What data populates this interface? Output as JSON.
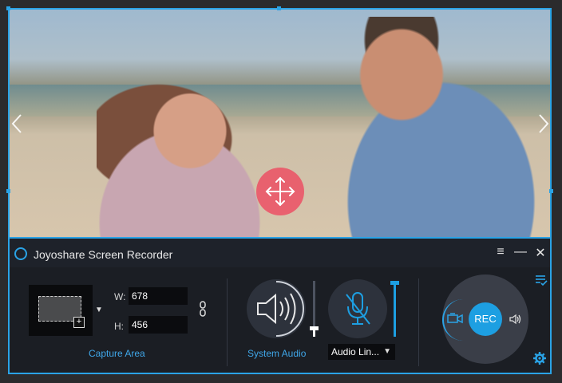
{
  "app": {
    "title": "Joyoshare Screen Recorder"
  },
  "window_controls": {
    "menu": "≡",
    "minimize": "—",
    "close": "✕"
  },
  "capture": {
    "width_label": "W:",
    "width_value": "678",
    "height_label": "H:",
    "height_value": "456",
    "section_label": "Capture Area"
  },
  "system_audio": {
    "section_label": "System Audio",
    "volume_level": 0.15
  },
  "microphone": {
    "selected_source": "Audio Lin...",
    "volume_level": 0.97,
    "muted": true
  },
  "record": {
    "rec_label": "REC"
  },
  "colors": {
    "accent": "#2aa3e6",
    "panel_bg": "#1b1e24",
    "rec_button": "#1d9fe2",
    "move_handle": "#ec5064"
  },
  "icons": [
    "app-logo-icon",
    "menu-icon",
    "minimize-icon",
    "close-icon",
    "prev-arrow-icon",
    "next-arrow-icon",
    "move-icon",
    "chevron-down-icon",
    "link-icon",
    "speaker-icon",
    "mic-muted-icon",
    "camera-icon",
    "volume-icon",
    "settings-gear-icon",
    "task-list-icon"
  ]
}
